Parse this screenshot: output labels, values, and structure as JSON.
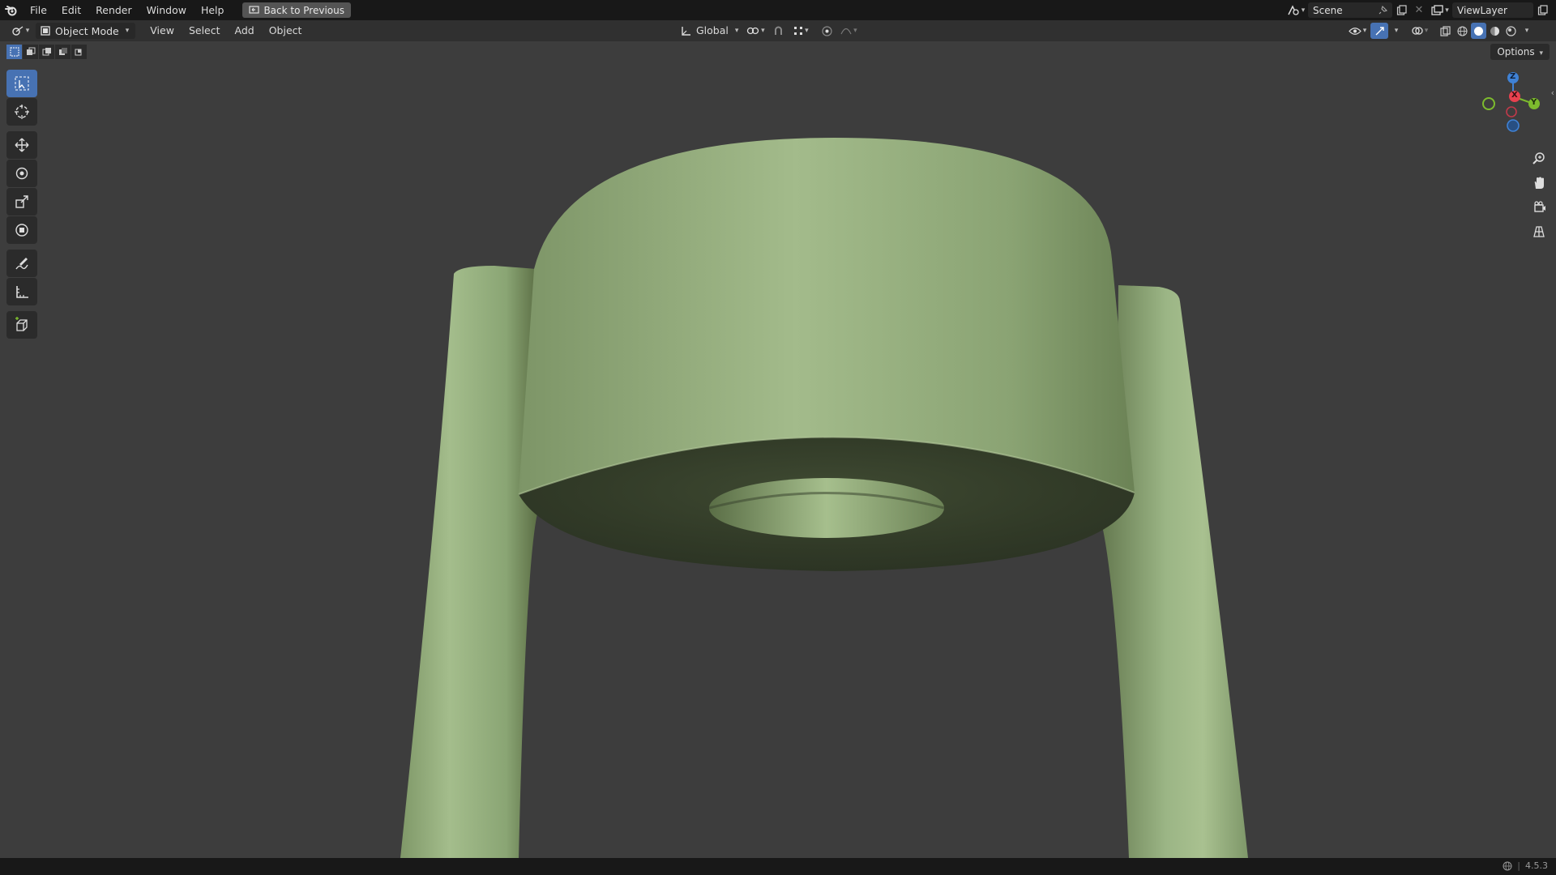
{
  "menu": {
    "file": "File",
    "edit": "Edit",
    "render": "Render",
    "window": "Window",
    "help": "Help",
    "back_to_previous": "Back to Previous"
  },
  "scene": {
    "name": "Scene"
  },
  "view_layer": {
    "name": "ViewLayer"
  },
  "header": {
    "mode": "Object Mode",
    "view": "View",
    "select": "Select",
    "add": "Add",
    "object": "Object",
    "transform_orientation": "Global"
  },
  "viewport": {
    "options_label": "Options",
    "gizmo": {
      "x": "X",
      "y": "Y",
      "z": "Z"
    },
    "object_color": "#8fa878"
  },
  "status": {
    "version": "4.5.3"
  },
  "colors": {
    "accent": "#4772b3",
    "axis_x": "#e8414f",
    "axis_y": "#7dbb2e",
    "axis_z": "#3f82d6"
  }
}
